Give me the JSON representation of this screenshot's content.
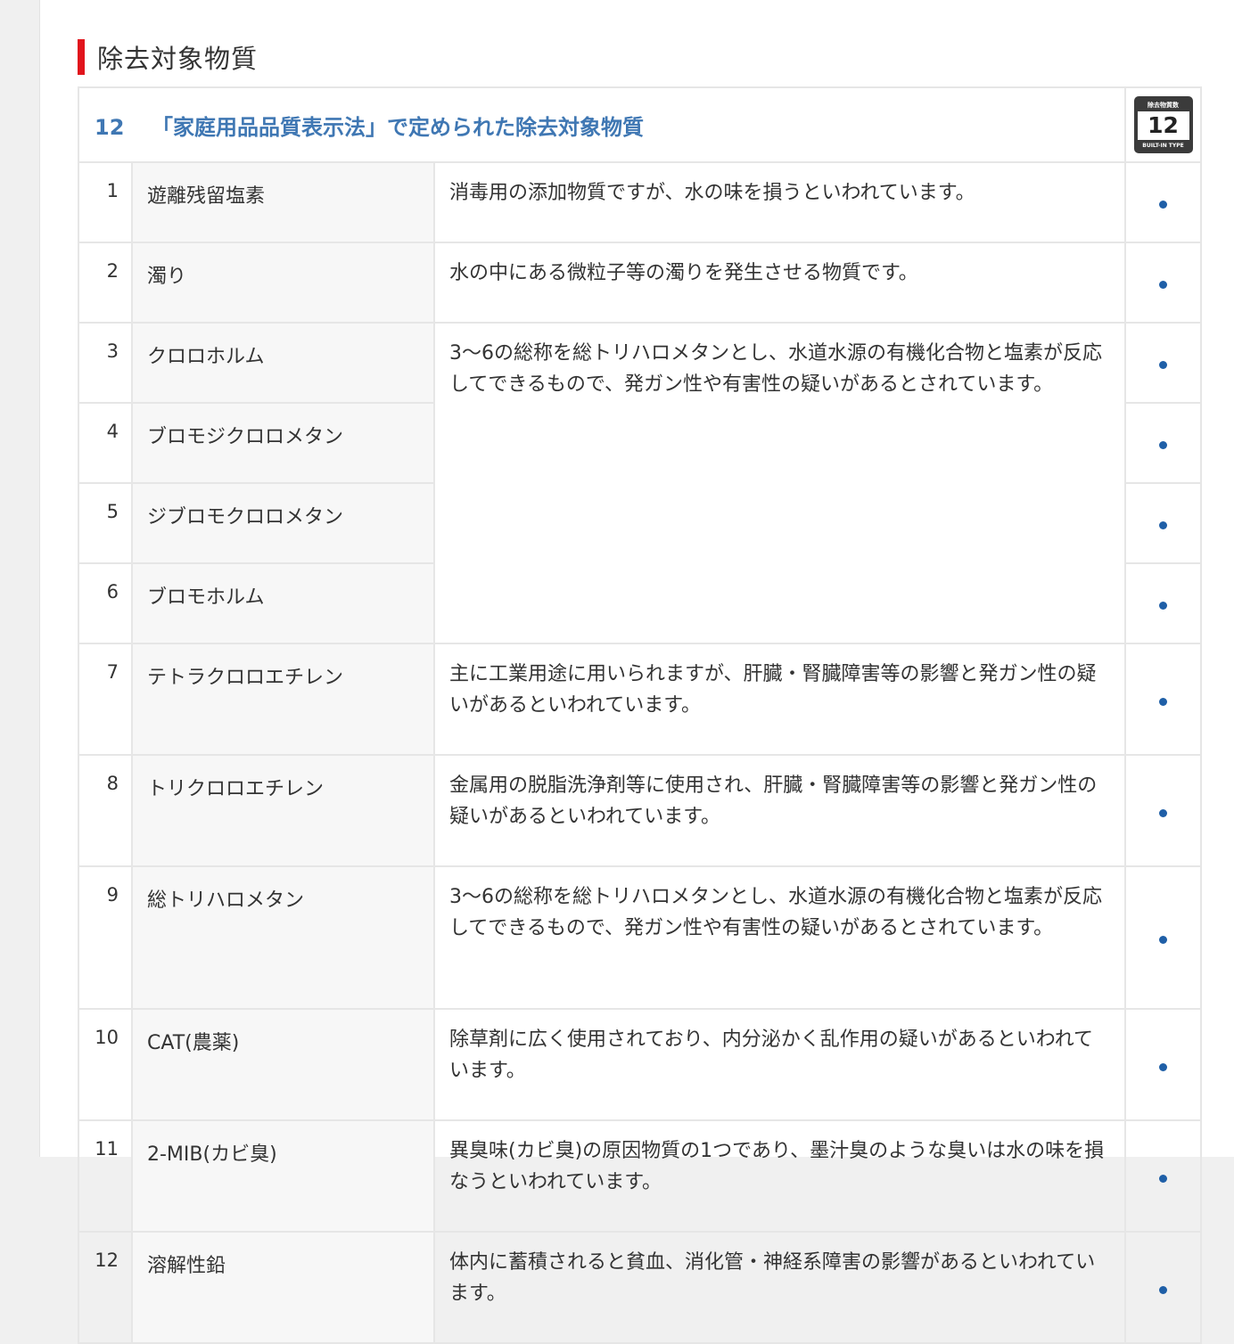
{
  "section": {
    "title": "除去対象物質"
  },
  "header": {
    "number": "12",
    "title": "「家庭用品品質表示法」で定められた除去対象物質",
    "badge": {
      "top": "除去物質数",
      "count": "12",
      "bottom": "BUILT-IN TYPE"
    }
  },
  "rows": [
    {
      "no": "1",
      "name": "遊離残留塩素",
      "desc": "消毒用の添加物質ですが、水の味を損うといわれています。",
      "mark": "●"
    },
    {
      "no": "2",
      "name": "濁り",
      "desc": "水の中にある微粒子等の濁りを発生させる物質です。",
      "mark": "●"
    },
    {
      "no": "3",
      "name": "クロロホルム",
      "desc": "3～6の総称を総トリハロメタンとし、水道水源の有機化合物と塩素が反応してできるもので、発ガン性や有害性の疑いがあるとされています。",
      "mark": "●"
    },
    {
      "no": "4",
      "name": "ブロモジクロロメタン",
      "mark": "●"
    },
    {
      "no": "5",
      "name": "ジブロモクロロメタン",
      "mark": "●"
    },
    {
      "no": "6",
      "name": "ブロモホルム",
      "mark": "●"
    },
    {
      "no": "7",
      "name": "テトラクロロエチレン",
      "desc": "主に工業用途に用いられますが、肝臓・腎臓障害等の影響と発ガン性の疑いがあるといわれています。",
      "mark": "●"
    },
    {
      "no": "8",
      "name": "トリクロロエチレン",
      "desc": "金属用の脱脂洗浄剤等に使用され、肝臓・腎臓障害等の影響と発ガン性の疑いがあるといわれています。",
      "mark": "●"
    },
    {
      "no": "9",
      "name": "総トリハロメタン",
      "desc": "3～6の総称を総トリハロメタンとし、水道水源の有機化合物と塩素が反応してできるもので、発ガン性や有害性の疑いがあるとされています。",
      "mark": "●"
    },
    {
      "no": "10",
      "name": "CAT(農薬)",
      "desc": "除草剤に広く使用されており、内分泌かく乱作用の疑いがあるといわれています。",
      "mark": "●"
    },
    {
      "no": "11",
      "name": "2-MIB(カビ臭)",
      "desc": "異臭味(カビ臭)の原因物質の1つであり、墨汁臭のような臭いは水の味を損なうといわれています。",
      "mark": "●"
    },
    {
      "no": "12",
      "name": "溶解性鉛",
      "desc": "体内に蓄積されると貧血、消化管・神経系障害の影響があるといわれています。",
      "mark": "●"
    }
  ]
}
